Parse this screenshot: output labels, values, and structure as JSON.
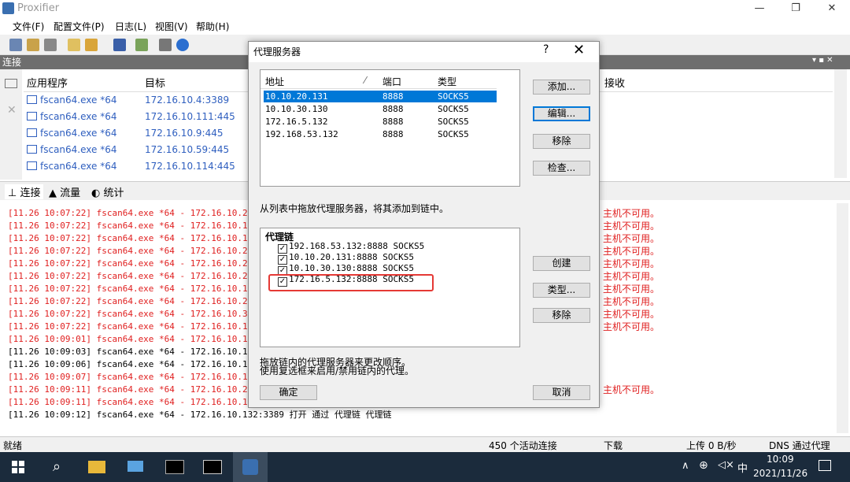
{
  "window": {
    "title": "Proxifier",
    "min": "—",
    "max": "❐",
    "close": "✕"
  },
  "menu": [
    "文件(F)",
    "配置文件(P)",
    "日志(L)",
    "视图(V)",
    "帮助(H)"
  ],
  "connections": {
    "header": "连接",
    "col_app": "应用程序",
    "col_target": "目标",
    "col_recv": "接收",
    "rows": [
      {
        "app": "fscan64.exe *64",
        "target": "172.16.10.4:3389"
      },
      {
        "app": "fscan64.exe *64",
        "target": "172.16.10.111:445"
      },
      {
        "app": "fscan64.exe *64",
        "target": "172.16.10.9:445"
      },
      {
        "app": "fscan64.exe *64",
        "target": "172.16.10.59:445"
      },
      {
        "app": "fscan64.exe *64",
        "target": "172.16.10.114:445"
      }
    ]
  },
  "tabs": {
    "connections": "连接",
    "traffic": "流量",
    "stats": "统计"
  },
  "log": [
    {
      "t": "[11.26 10:07:22] fscan64.exe *64 - 172.16.10.24:3389",
      "red": true,
      "tail": "主机不可用。"
    },
    {
      "t": "[11.26 10:07:22] fscan64.exe *64 - 172.16.10.192:338",
      "red": true,
      "tail": "主机不可用。"
    },
    {
      "t": "[11.26 10:07:22] fscan64.exe *64 - 172.16.10.100:338",
      "red": true,
      "tail": "主机不可用。"
    },
    {
      "t": "[11.26 10:07:22] fscan64.exe *64 - 172.16.10.216:338",
      "red": true,
      "tail": "主机不可用。"
    },
    {
      "t": "[11.26 10:07:22] fscan64.exe *64 - 172.16.10.238:338",
      "red": true,
      "tail": "主机不可用。"
    },
    {
      "t": "[11.26 10:07:22] fscan64.exe *64 - 172.16.10.201:338",
      "red": true,
      "tail": "主机不可用。"
    },
    {
      "t": "[11.26 10:07:22] fscan64.exe *64 - 172.16.10.12:3389",
      "red": true,
      "tail": "主机不可用。"
    },
    {
      "t": "[11.26 10:07:22] fscan64.exe *64 - 172.16.10.236:338",
      "red": true,
      "tail": "主机不可用。"
    },
    {
      "t": "[11.26 10:07:22] fscan64.exe *64 - 172.16.10.37:445",
      "red": true,
      "tail": "主机不可用。"
    },
    {
      "t": "[11.26 10:07:22] fscan64.exe *64 - 172.16.10.160:445",
      "red": true,
      "tail": "主机不可用。"
    },
    {
      "t": "[11.26 10:09:01] fscan64.exe *64 - 172.16.10.128:445",
      "red": true,
      "tail": ""
    },
    {
      "t": "[11.26 10:09:03] fscan64.exe *64 - 172.16.10.132:338",
      "red": false,
      "tail": ""
    },
    {
      "t": "[11.26 10:09:06] fscan64.exe *64 - 172.16.10.132:338",
      "red": false,
      "tail": ""
    },
    {
      "t": "[11.26 10:09:07] fscan64.exe *64 - 172.16.10.132:445",
      "red": true,
      "tail": ""
    },
    {
      "t": "[11.26 10:09:11] fscan64.exe *64 - 172.16.10.255:445",
      "red": true,
      "tail": "主机不可用。"
    },
    {
      "t": "[11.26 10:09:11] fscan64.exe *64 - 172.16.10.128:338",
      "red": true,
      "tail": ""
    },
    {
      "t": "[11.26 10:09:12] fscan64.exe *64 - 172.16.10.132:3389 打开 通过 代理链 代理链",
      "red": false,
      "tail": ""
    }
  ],
  "status": {
    "ready": "就绪",
    "active": "450 个活动连接",
    "down": "下载",
    "up": "上传 0 B/秒",
    "dns": "DNS 通过代理"
  },
  "dialog": {
    "title": "代理服务器",
    "help": "?",
    "close": "✕",
    "col_addr": "地址",
    "col_port": "端口",
    "col_type": "类型",
    "servers": [
      {
        "addr": "10.10.20.131",
        "port": "8888",
        "type": "SOCKS5"
      },
      {
        "addr": "10.10.30.130",
        "port": "8888",
        "type": "SOCKS5"
      },
      {
        "addr": "172.16.5.132",
        "port": "8888",
        "type": "SOCKS5"
      },
      {
        "addr": "192.168.53.132",
        "port": "8888",
        "type": "SOCKS5"
      }
    ],
    "btn_add": "添加...",
    "btn_edit": "编辑...",
    "btn_remove": "移除",
    "btn_check": "检查...",
    "hint1": "从列表中拖放代理服务器，将其添加到链中。",
    "chain_title": "代理链",
    "chain": [
      "192.168.53.132:8888 SOCKS5",
      "10.10.20.131:8888 SOCKS5",
      "10.10.30.130:8888 SOCKS5",
      "172.16.5.132:8888 SOCKS5"
    ],
    "btn_create": "创建",
    "btn_type": "类型...",
    "btn_remove2": "移除",
    "hint2": "拖放链内的代理服务器来更改顺序。",
    "hint3": "使用复选框来启用/禁用链内的代理。",
    "btn_ok": "确定",
    "btn_cancel": "取消"
  },
  "taskbar": {
    "ime": "中",
    "time": "10:09",
    "date": "2021/11/26"
  }
}
